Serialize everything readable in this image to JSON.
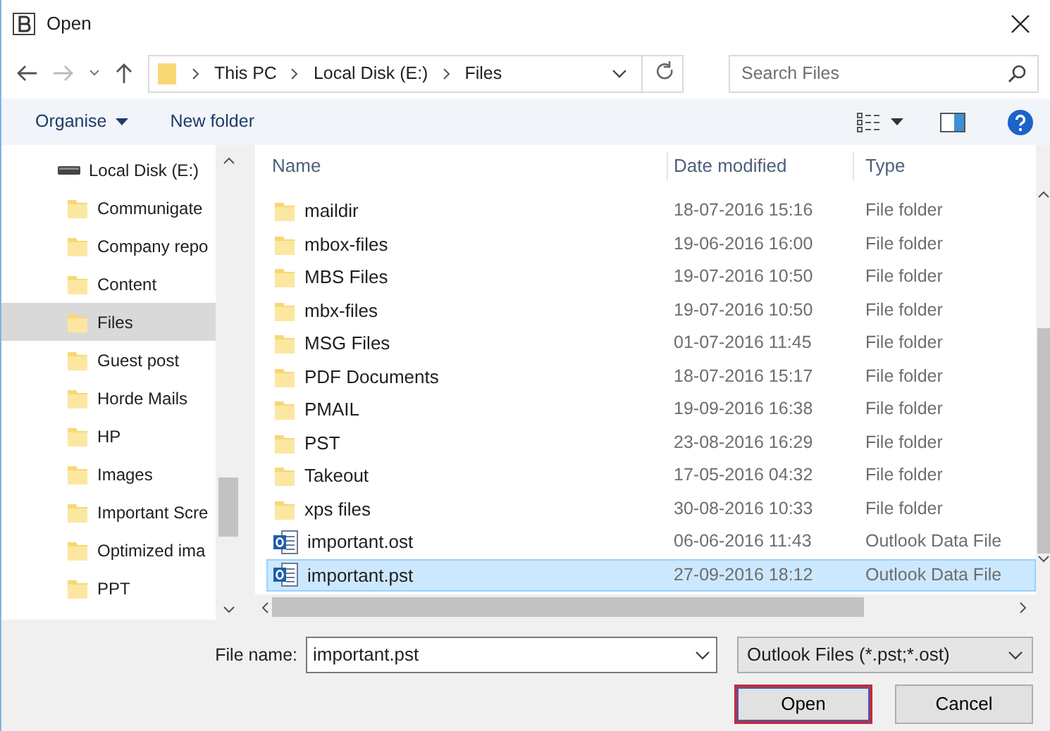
{
  "window": {
    "title": "Open"
  },
  "address": {
    "crumbs": [
      "This PC",
      "Local Disk (E:)",
      "Files"
    ]
  },
  "search": {
    "placeholder": "Search Files"
  },
  "toolbar": {
    "organise": "Organise",
    "new_folder": "New folder"
  },
  "sidebar": {
    "items": [
      {
        "label": "Local Disk (E:)",
        "kind": "drive",
        "selected": false,
        "children": [
          {
            "label": "Communigate",
            "kind": "folder",
            "selected": false
          },
          {
            "label": "Company repo",
            "kind": "folder",
            "selected": false
          },
          {
            "label": "Content",
            "kind": "folder",
            "selected": false
          },
          {
            "label": "Files",
            "kind": "folder",
            "selected": true
          },
          {
            "label": "Guest post",
            "kind": "folder",
            "selected": false
          },
          {
            "label": "Horde Mails",
            "kind": "folder",
            "selected": false
          },
          {
            "label": "HP",
            "kind": "folder",
            "selected": false
          },
          {
            "label": "Images",
            "kind": "folder",
            "selected": false
          },
          {
            "label": "Important Scre",
            "kind": "folder",
            "selected": false
          },
          {
            "label": "Optimized ima",
            "kind": "folder",
            "selected": false
          },
          {
            "label": "PPT",
            "kind": "folder",
            "selected": false
          }
        ]
      }
    ]
  },
  "table": {
    "columns": [
      "Name",
      "Date modified",
      "Type"
    ],
    "rows": [
      {
        "name": "maildir",
        "date": "18-07-2016 15:16",
        "type": "File folder",
        "kind": "folder",
        "selected": false
      },
      {
        "name": "mbox-files",
        "date": "19-06-2016 16:00",
        "type": "File folder",
        "kind": "folder",
        "selected": false
      },
      {
        "name": "MBS Files",
        "date": "19-07-2016 10:50",
        "type": "File folder",
        "kind": "folder",
        "selected": false
      },
      {
        "name": "mbx-files",
        "date": "19-07-2016 10:50",
        "type": "File folder",
        "kind": "folder",
        "selected": false
      },
      {
        "name": "MSG Files",
        "date": "01-07-2016 11:45",
        "type": "File folder",
        "kind": "folder",
        "selected": false
      },
      {
        "name": "PDF Documents",
        "date": "18-07-2016 15:17",
        "type": "File folder",
        "kind": "folder",
        "selected": false
      },
      {
        "name": "PMAIL",
        "date": "19-09-2016 16:38",
        "type": "File folder",
        "kind": "folder",
        "selected": false
      },
      {
        "name": "PST",
        "date": "23-08-2016 16:29",
        "type": "File folder",
        "kind": "folder",
        "selected": false
      },
      {
        "name": "Takeout",
        "date": "17-05-2016 04:32",
        "type": "File folder",
        "kind": "folder",
        "selected": false
      },
      {
        "name": "xps files",
        "date": "30-08-2016 10:33",
        "type": "File folder",
        "kind": "folder",
        "selected": false
      },
      {
        "name": "important.ost",
        "date": "06-06-2016 11:43",
        "type": "Outlook Data File",
        "kind": "datafile",
        "selected": false
      },
      {
        "name": "important.pst",
        "date": "27-09-2016 18:12",
        "type": "Outlook Data File",
        "kind": "datafile",
        "selected": true
      }
    ]
  },
  "footer": {
    "file_name_label": "File name:",
    "file_name": "important.pst",
    "filter": "Outlook Files (*.pst;*.ost)",
    "buttons": [
      "Open",
      "Cancel"
    ]
  }
}
